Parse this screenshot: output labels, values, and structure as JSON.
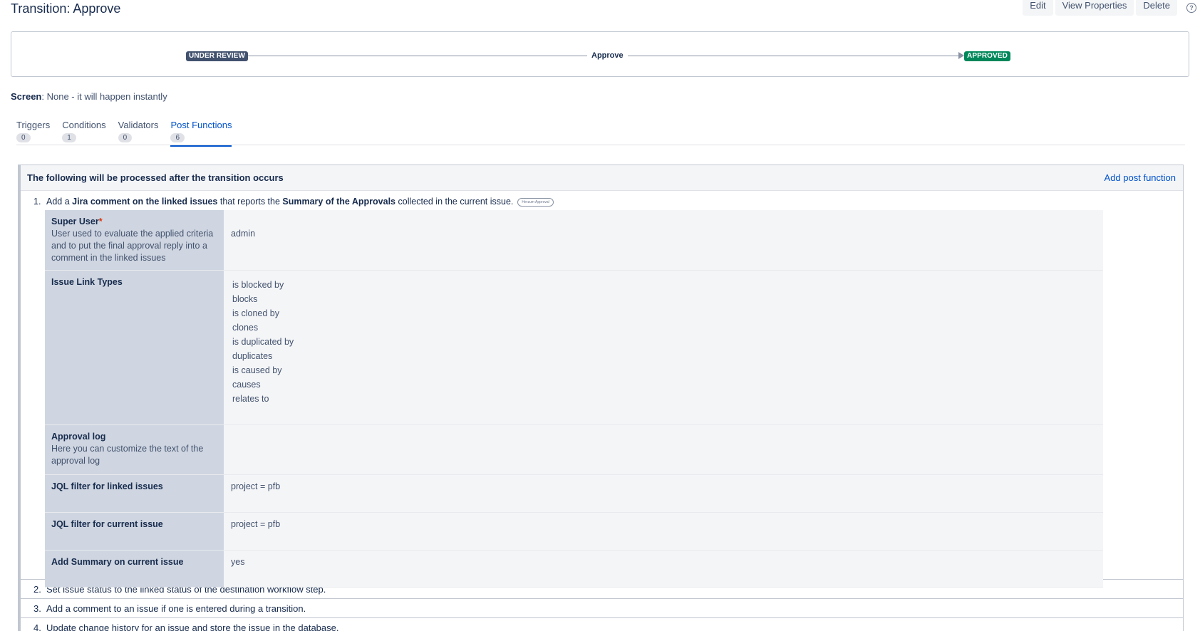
{
  "page": {
    "title": "Transition: Approve",
    "actions": [
      "Edit",
      "View Properties",
      "Delete"
    ]
  },
  "diagram": {
    "from_status": "UNDER REVIEW",
    "transition": "Approve",
    "to_status": "APPROVED"
  },
  "screen": {
    "label": "Screen",
    "value": ": None - it will happen instantly"
  },
  "tabs": [
    {
      "label": "Triggers",
      "count": "0"
    },
    {
      "label": "Conditions",
      "count": "1"
    },
    {
      "label": "Validators",
      "count": "0"
    },
    {
      "label": "Post Functions",
      "count": "6",
      "active": true
    }
  ],
  "panel": {
    "header": "The following will be processed after the transition occurs",
    "add_link": "Add post function"
  },
  "post_functions": {
    "first": {
      "number": "1.",
      "text_1": "Add a ",
      "bold_1": "Jira comment on the linked issues",
      "text_2": " that reports the ",
      "bold_2": "Summary of the Approvals",
      "text_3": " collected in the current issue.",
      "badge": "Herzum Approval",
      "config": {
        "super_user": {
          "label": "Super User",
          "required": "*",
          "desc": "User used to evaluate the applied criteria and to put the final approval reply into a comment in the linked issues",
          "value": "admin"
        },
        "link_types": {
          "label": "Issue Link Types",
          "values": [
            "is blocked by",
            "blocks",
            "is cloned by",
            "clones",
            "is duplicated by",
            "duplicates",
            "is caused by",
            "causes",
            "relates to"
          ]
        },
        "approval_log": {
          "label": "Approval log",
          "desc": "Here you can customize the text of the approval log",
          "value": ""
        },
        "jql_linked": {
          "label": "JQL filter for linked issues",
          "value": "project = pfb"
        },
        "jql_current": {
          "label": "JQL filter for current issue",
          "value": "project = pfb"
        },
        "add_summary": {
          "label": "Add Summary on current issue",
          "value": "yes"
        }
      }
    },
    "others": [
      {
        "number": "2.",
        "text": "Set issue status to the linked status of the destination workflow step."
      },
      {
        "number": "3.",
        "text": "Add a comment to an issue if one is entered during a transition."
      },
      {
        "number": "4.",
        "text": "Update change history for an issue and store the issue in the database."
      }
    ]
  }
}
